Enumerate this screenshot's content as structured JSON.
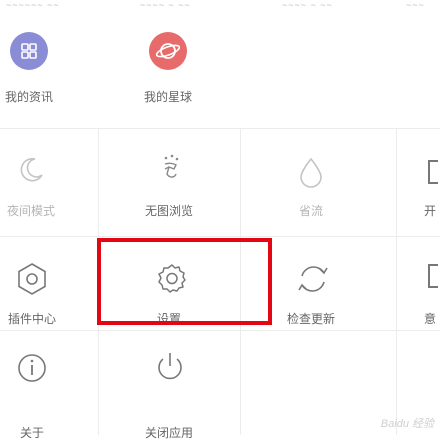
{
  "top_strip": [
    "~~~~~~ ~~",
    "~~~~ ~ ~~",
    "~~~~ ~ ~~",
    "~~~"
  ],
  "tiles": {
    "my_profile": {
      "label": "我的资讯",
      "icon": "grid-icon",
      "color": "#8a8dd6"
    },
    "my_planet": {
      "label": "我的星球",
      "icon": "planet-icon",
      "color": "#e76b6b"
    },
    "night_mode": {
      "label": "夜间模式",
      "icon": "moon-icon"
    },
    "no_image": {
      "label": "无图浏览",
      "icon": "no-image-icon"
    },
    "save_water": {
      "label": "省流",
      "icon": "water-drop-icon"
    },
    "plugin_center": {
      "label": "插件中心",
      "icon": "hexagon-gear-icon"
    },
    "settings": {
      "label": "设置",
      "icon": "gear-icon"
    },
    "check_update": {
      "label": "检查更新",
      "icon": "refresh-icon"
    },
    "about": {
      "label": "关于",
      "icon": "info-icon"
    },
    "close_app": {
      "label": "关闭应用",
      "icon": "power-icon"
    }
  },
  "right_edge": {
    "row2_label": "开",
    "row3_label": "意"
  },
  "watermark": "Baidu 经验",
  "accent_color": "#e30613"
}
